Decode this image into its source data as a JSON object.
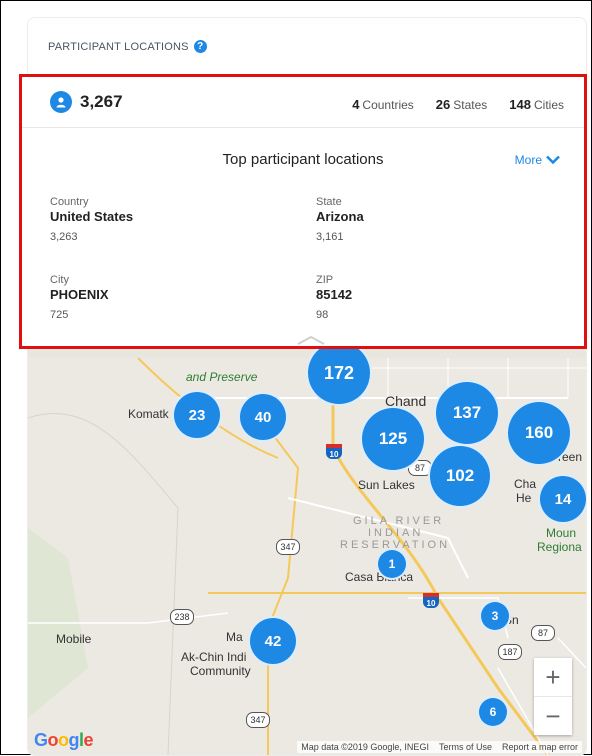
{
  "header": {
    "title": "PARTICIPANT LOCATIONS"
  },
  "summary": {
    "total": "3,267",
    "countries": {
      "value": "4",
      "label": "Countries"
    },
    "states": {
      "value": "26",
      "label": "States"
    },
    "cities": {
      "value": "148",
      "label": "Cities"
    }
  },
  "top": {
    "title": "Top participant locations",
    "more_label": "More",
    "country": {
      "label": "Country",
      "value": "United States",
      "count": "3,263"
    },
    "state": {
      "label": "State",
      "value": "Arizona",
      "count": "3,161"
    },
    "city": {
      "label": "City",
      "value": "PHOENIX",
      "count": "725"
    },
    "zip": {
      "label": "ZIP",
      "value": "85142",
      "count": "98"
    }
  },
  "map": {
    "clusters": [
      "172",
      "23",
      "40",
      "137",
      "125",
      "160",
      "102",
      "14",
      "1",
      "3",
      "42",
      "6"
    ],
    "labels": {
      "preserve": "and Preserve",
      "komatke": "Komatk",
      "chandler": "Chand",
      "sunlakes": "Sun Lakes",
      "gila": "GILA RIVER",
      "indian": "INDIAN",
      "reservation": "RESERVATION",
      "casablanca": "Casa Blanca",
      "mobile": "Mobile",
      "maricopa": "Ma",
      "akchin1": "Ak-Chin Indi",
      "akchin2": "Community",
      "chandlerh": "Cha",
      "he": "He",
      "moun": "Moun",
      "regional": "Regiona",
      "green": "reen",
      "san": "S",
      "on": "n"
    },
    "shields": {
      "i10a": "10",
      "i10b": "10",
      "r87a": "87",
      "r87b": "87",
      "r347a": "347",
      "r347b": "347",
      "r238": "238",
      "r187": "187"
    },
    "zoom_in": "+",
    "zoom_out": "−",
    "google": "Google",
    "attribution": {
      "data": "Map data ©2019 Google, INEGI",
      "terms": "Terms of Use",
      "report": "Report a map error"
    }
  },
  "colors": {
    "accent": "#1e88e5",
    "highlight": "#e01010"
  }
}
